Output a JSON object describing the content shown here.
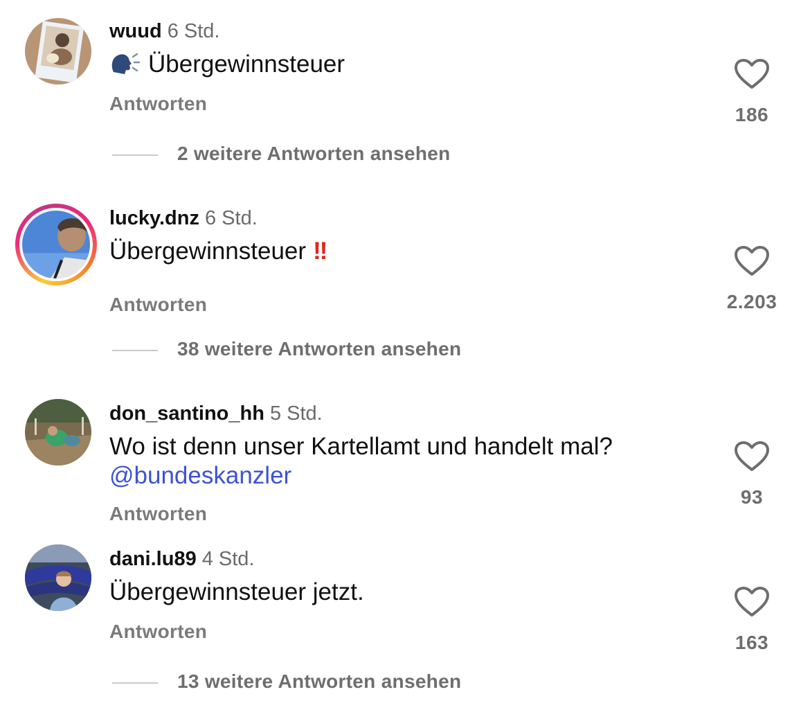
{
  "comments": [
    {
      "username": "wuud",
      "time": "6 Std.",
      "text": "Übergewinnsteuer",
      "leading_emoji": "speaking-head-emoji",
      "reply_label": "Antworten",
      "likes": "186",
      "more_replies": "2 weitere Antworten ansehen",
      "has_story_ring": false
    },
    {
      "username": "lucky.dnz",
      "time": "6 Std.",
      "text": "Übergewinnsteuer",
      "trailing_emoji": "‼",
      "reply_label": "Antworten",
      "likes": "2.203",
      "more_replies": "38 weitere Antworten ansehen",
      "has_story_ring": true
    },
    {
      "username": "don_santino_hh",
      "time": "5 Std.",
      "text": "Wo ist denn unser Kartellamt und handelt mal?",
      "mention": "@bundeskanzler",
      "reply_label": "Antworten",
      "likes": "93",
      "has_story_ring": false
    },
    {
      "username": "dani.lu89",
      "time": "4 Std.",
      "text": "Übergewinnsteuer jetzt.",
      "reply_label": "Antworten",
      "likes": "163",
      "more_replies": "13 weitere Antworten ansehen",
      "has_story_ring": false
    }
  ],
  "colors": {
    "mention": "#3d52d5",
    "emoji_red": "#e0251b",
    "secondary_text": "#6e6e6e"
  },
  "icons": {
    "like": "heart-outline-icon"
  }
}
